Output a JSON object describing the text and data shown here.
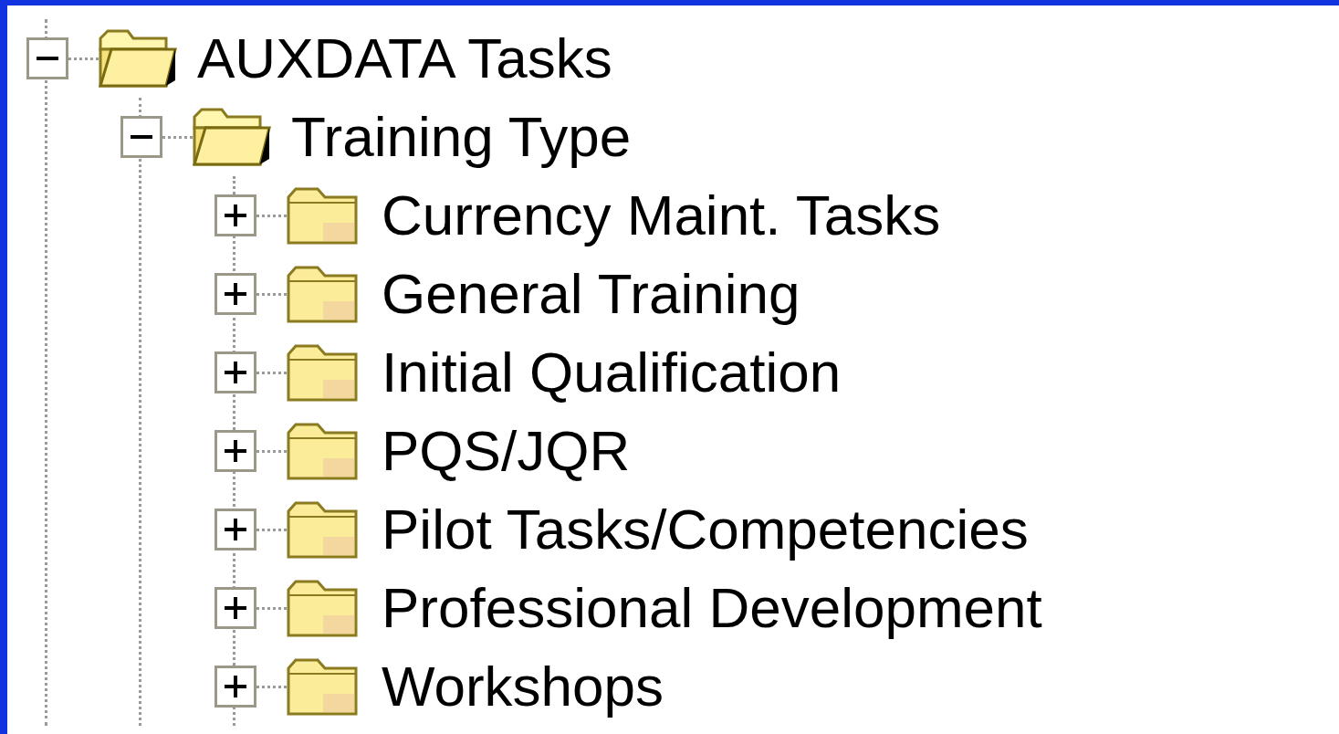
{
  "tree": [
    {
      "label": "AUXDATA Tasks",
      "expanded": true,
      "children": [
        {
          "label": "Training Type",
          "expanded": true,
          "children": [
            {
              "label": "Currency Maint. Tasks",
              "expanded": false
            },
            {
              "label": "General Training",
              "expanded": false
            },
            {
              "label": "Initial Qualification",
              "expanded": false
            },
            {
              "label": "PQS/JQR",
              "expanded": false
            },
            {
              "label": "Pilot Tasks/Competencies",
              "expanded": false
            },
            {
              "label": "Professional Development",
              "expanded": false
            },
            {
              "label": "Workshops",
              "expanded": false
            }
          ]
        }
      ]
    }
  ]
}
